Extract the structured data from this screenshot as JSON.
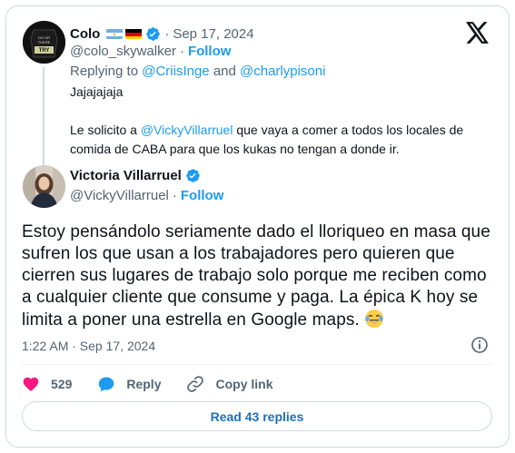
{
  "parent_tweet": {
    "name": "Colo",
    "date": "Sep 17, 2024",
    "handle": "@colo_skywalker",
    "follow": "Follow",
    "replying_prefix": "Replying to",
    "replying_user1": "@CriisInge",
    "replying_and": "and",
    "replying_user2": "@charlypisoni",
    "text_line1": "Jajajajaja",
    "text_pre": "Le solicito a ",
    "text_mention": "@VickyVillarruel",
    "text_post": " que vaya a comer a todos los locales de comida de CABA para que los kukas no tengan a donde ir.",
    "avatar_text": "DO OR DO NOT THERE IS NO TRY",
    "flags": [
      "argentina-flag-icon",
      "germany-flag-icon"
    ]
  },
  "main_tweet": {
    "name": "Victoria Villarruel",
    "handle": "@VickyVillarruel",
    "follow": "Follow",
    "text": "Estoy pensándolo seriamente dado el lloriqueo en masa que sufren los que usan a los trabajadores pero quieren que cierren sus lugares de trabajo solo porque me reciben como a cualquier cliente que consume y paga. La épica K hoy se limita a poner una estrella en Google maps.",
    "emoji": "joy-emoji-icon",
    "time": "1:22 AM · Sep 17, 2024"
  },
  "actions": {
    "likes": "529",
    "reply_label": "Reply",
    "copy_label": "Copy link"
  },
  "read_replies": "Read 43 replies",
  "colors": {
    "accent": "#1d9bf0",
    "like": "#f91880",
    "muted": "#536471",
    "border": "#cfd9de"
  }
}
